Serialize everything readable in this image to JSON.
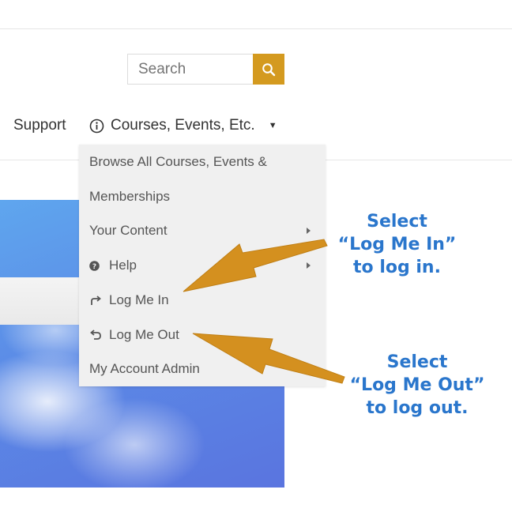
{
  "search": {
    "placeholder": "Search"
  },
  "nav": {
    "support_label": "Support",
    "courses_label": "Courses, Events, Etc."
  },
  "dropdown": {
    "items": [
      {
        "label": "Browse All Courses, Events &",
        "icon": ""
      },
      {
        "label": "Memberships",
        "icon": ""
      },
      {
        "label": "Your Content",
        "icon": "",
        "submenu": true
      },
      {
        "label": "Help",
        "icon": "question-circle-icon",
        "submenu": true
      },
      {
        "label": "Log Me In",
        "icon": "share-arrow-icon"
      },
      {
        "label": "Log Me Out",
        "icon": "undo-arrow-icon"
      },
      {
        "label": "My Account Admin",
        "icon": ""
      }
    ]
  },
  "annotations": {
    "login": {
      "line1": "Select",
      "line2": "“Log Me In”",
      "line3": "to log in."
    },
    "logout": {
      "line1": "Select",
      "line2": "“Log Me Out”",
      "line3": "to log out."
    }
  },
  "colors": {
    "accent": "#d49a1f",
    "arrow": "#d4901f",
    "callout_text": "#2a76cc",
    "menu_bg": "#f0f0f0",
    "sky": "#5b8ae6"
  }
}
